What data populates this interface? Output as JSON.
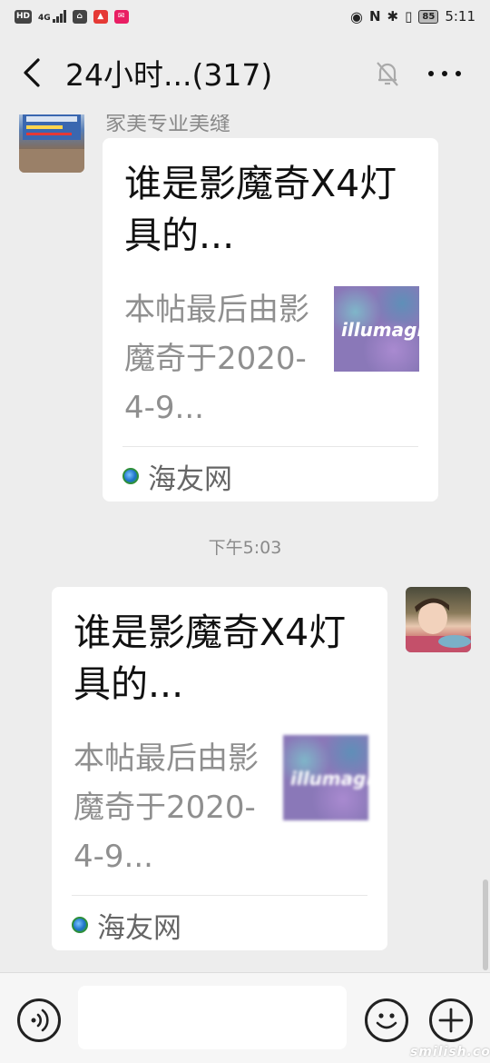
{
  "status_bar": {
    "hd": "HD",
    "network": "4G",
    "battery": "85",
    "time": "5:11"
  },
  "header": {
    "title": "24小时...(317)",
    "icons": {
      "back": "chevron-left-icon",
      "mute": "bell-muted-icon",
      "more": "more-dots-icon"
    }
  },
  "messages": [
    {
      "sender": "家美专业美缝",
      "card": {
        "title": "谁是影魔奇X4灯具的...",
        "description": "本帖最后由影魔奇于2020-4-9...",
        "thumbnail_text": "illumagi",
        "source": "海友网"
      }
    },
    {
      "card": {
        "title": "谁是影魔奇X4灯具的...",
        "description": "本帖最后由影魔奇于2020-4-9...",
        "thumbnail_text": "illumagi",
        "source": "海友网"
      }
    }
  ],
  "time_divider": "下午5:03",
  "input_bar": {
    "placeholder": "",
    "icons": {
      "voice": "voice-icon",
      "emoji": "emoji-icon",
      "plus": "plus-icon"
    }
  },
  "watermark": "smilish.com",
  "colors": {
    "background": "#ededed",
    "card": "#ffffff",
    "muted_text": "#8f8f8f"
  }
}
